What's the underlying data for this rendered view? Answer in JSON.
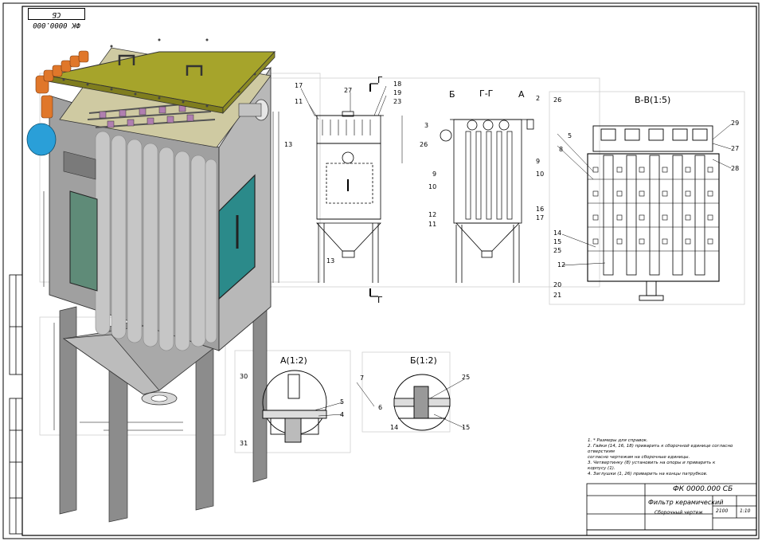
{
  "drawing": {
    "corner_stamp": "ФК 0000.000 СБ",
    "document_code": "ФК 0000.000 СБ",
    "product_name": "Фильтр керамический",
    "document_type": "Сборочный чертеж",
    "mass": "2100",
    "scale": "1:10"
  },
  "views": {
    "section_gg": "Г-Г",
    "section_vv": "В-В(1:5)",
    "detail_a": "А(1:2)",
    "detail_b": "Б(1:2)",
    "mark_b": "Б",
    "mark_a": "А",
    "cut_g_top": "Г",
    "cut_g_bottom": "Г"
  },
  "callouts": {
    "front": [
      "17",
      "11",
      "18",
      "19",
      "23",
      "27",
      "13",
      "13"
    ],
    "side": [
      "2",
      "26",
      "3",
      "26",
      "9",
      "10",
      "5",
      "8",
      "9",
      "10",
      "16",
      "17",
      "12",
      "11"
    ],
    "section_vv": [
      "29",
      "27",
      "28",
      "14",
      "15",
      "25",
      "12",
      "20",
      "21"
    ],
    "detail_a": [
      "30",
      "5",
      "4",
      "31"
    ],
    "detail_b": [
      "7",
      "25",
      "6",
      "14",
      "15"
    ]
  },
  "notes": [
    "1. * Размеры для справок.",
    "2. Гайки (14, 16, 18) приварить к сборочной единице согласно отверстиям",
    "согласно чертежам на сборочные единицы.",
    "3. Четвертинку (8) установить на опоры и приварить к",
    "корпусу (1).",
    "4. Заглушки (1, 26) приварить на концы патрубков."
  ],
  "colors": {
    "lid": "#a6a42b",
    "body": "#9a9a9a",
    "tube": "#c3c3c3",
    "hatch": "#2b8a8a",
    "blue_tank": "#2a9fd8",
    "orange_pipe": "#e0772a"
  }
}
